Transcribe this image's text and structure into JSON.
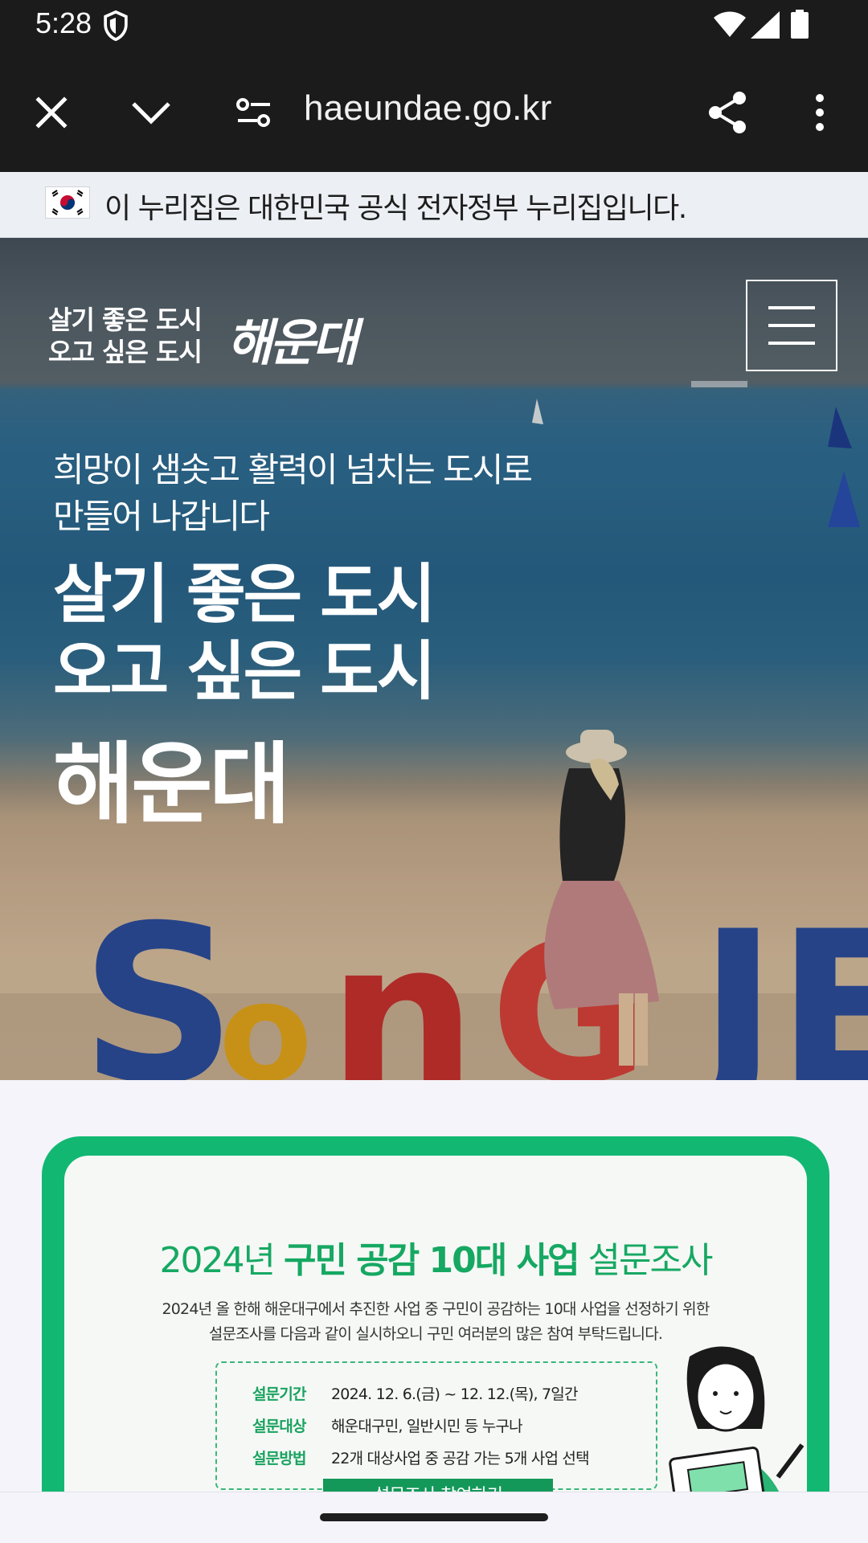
{
  "status_bar": {
    "time": "5:28",
    "icons": [
      "shield-icon",
      "wifi-icon",
      "signal-icon",
      "battery-icon"
    ]
  },
  "browser": {
    "url": "haeundae.go.kr",
    "icons": [
      "close-icon",
      "chevron-down-icon",
      "tune-icon",
      "share-icon",
      "more-vert-icon"
    ]
  },
  "gov_banner": {
    "text": "이 누리집은 대한민국 공식 전자정부 누리집입니다."
  },
  "hero": {
    "logo_line1": "살기 좋은 도시",
    "logo_line2": "오고 싶은 도시",
    "logo_script": "해운대",
    "subtitle_line1": "희망이 샘솟고 활력이 넘치는 도시로",
    "subtitle_line2": "만들어 나갑니다",
    "headline_line1": "살기 좋은 도시",
    "headline_line2": "오고 싶은 도시",
    "headline_big": "해운대",
    "sculpture_letters": "SonGJE"
  },
  "survey_card": {
    "title_pre": "2024년 ",
    "title_bold": "구민 공감 10대 사업",
    "title_post": " 설문조사",
    "desc_line1": "2024년 올 한해 해운대구에서 추진한 사업 중 구민이 공감하는 10대 사업을 선정하기 위한",
    "desc_line2": "설문조사를 다음과 같이 실시하오니 구민 여러분의 많은 참여 부탁드립니다.",
    "rows": [
      {
        "label": "설문기간",
        "value": "2024. 12. 6.(금) ~ 12. 12.(목), 7일간"
      },
      {
        "label": "설문대상",
        "value": "해운대구민, 일반시민 등 누구나"
      },
      {
        "label": "설문방법",
        "value": "22개 대상사업 중 공감 가는 5개 사업 선택"
      }
    ],
    "cta": "설문조사 참여하기"
  },
  "colors": {
    "toolbar_bg": "#1b1b1b",
    "accent_green": "#12b872",
    "title_green": "#16a862"
  }
}
